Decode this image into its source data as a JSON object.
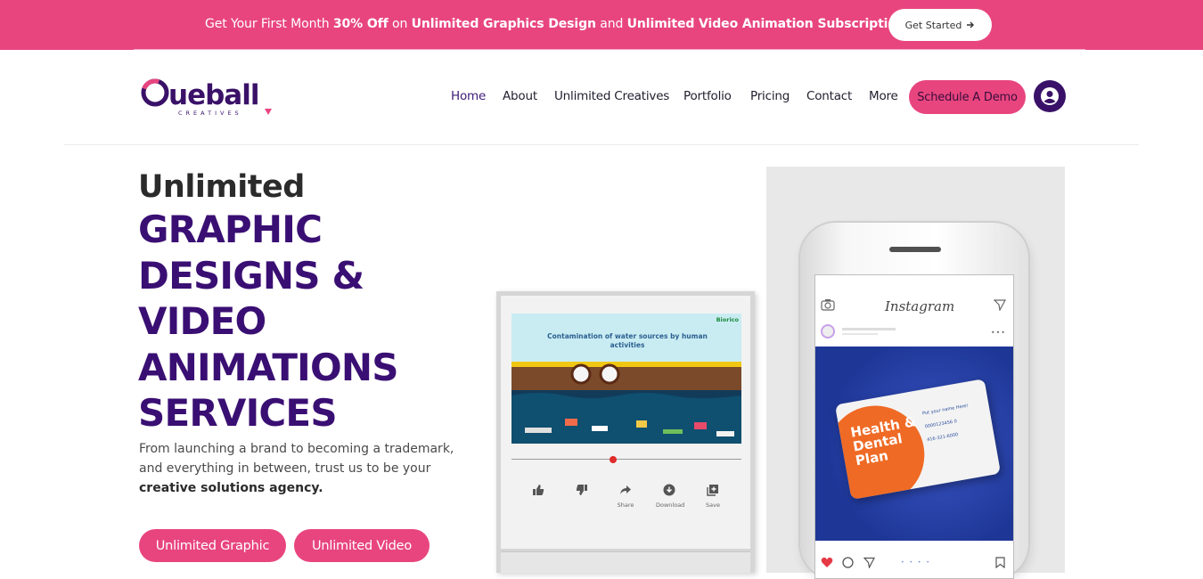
{
  "promo": {
    "text_1": "Get Your First Month ",
    "text_bold_1": "30% Off",
    "text_2": " on ",
    "text_bold_2": "Unlimited Graphics Design",
    "text_3": " and ",
    "text_bold_3": "Unlimited Video Animation Subscription.",
    "button_label": "Get Started",
    "button_icon": "arrow-right-icon"
  },
  "logo": {
    "wordmark": "Cueball",
    "tagline": "CREATIVES"
  },
  "nav": {
    "items": [
      {
        "label": "Home",
        "active": true
      },
      {
        "label": "About"
      },
      {
        "label": "Unlimited Creatives"
      },
      {
        "label": "Portfolio"
      },
      {
        "label": "Pricing"
      },
      {
        "label": "Contact"
      },
      {
        "label": "More"
      }
    ],
    "cta_label": "Schedule A Demo",
    "account_icon": "user-account-icon"
  },
  "hero": {
    "intro": "Unlimited",
    "lines": [
      "GRAPHIC",
      "DESIGNS &",
      "VIDEO",
      "ANIMATIONS",
      "SERVICES"
    ],
    "desc_1": "From launching a brand to becoming a trademark, and everything in between, trust us to be your ",
    "desc_bold": "creative solutions agency.",
    "buttons": [
      "Unlimited Graphic",
      "Unlimited Video"
    ]
  },
  "video_mock": {
    "caption": "Contamination of water sources by human activities",
    "brand": "Biorico",
    "controls": [
      {
        "icon": "thumbs-up-icon",
        "label": ""
      },
      {
        "icon": "thumbs-down-icon",
        "label": ""
      },
      {
        "icon": "share-icon",
        "label": "Share"
      },
      {
        "icon": "download-icon",
        "label": "Download"
      },
      {
        "icon": "save-icon",
        "label": "Save"
      }
    ]
  },
  "phone_mock": {
    "app_title": "Instagram",
    "card_title": "Health & Dental Plan",
    "card_fields": [
      "Put your name Here!",
      "0000123456 0",
      "416-321-6000"
    ]
  },
  "colors": {
    "brand_pink": "#e8457f",
    "brand_purple": "#3a0f73",
    "dark_purple": "#3a1168"
  }
}
